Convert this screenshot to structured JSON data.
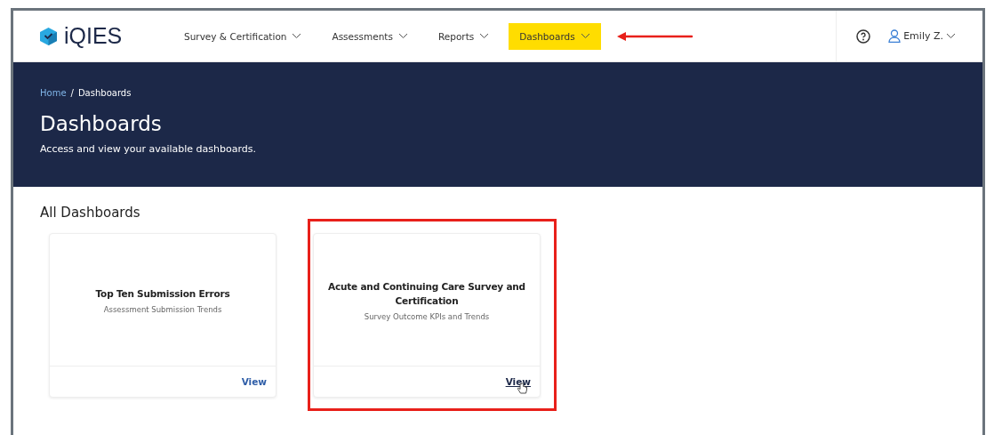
{
  "header": {
    "logo": "iQIES",
    "nav": [
      {
        "label": "Survey & Certification",
        "selected": false
      },
      {
        "label": "Assessments",
        "selected": false
      },
      {
        "label": "Reports",
        "selected": false
      },
      {
        "label": "Dashboards",
        "selected": true
      }
    ],
    "user": "Emily Z."
  },
  "banner": {
    "breadcrumb": [
      {
        "label": "Home",
        "kind": "link"
      },
      {
        "label": "/",
        "kind": "separator"
      },
      {
        "label": "Dashboards",
        "kind": "current"
      }
    ],
    "title": "Dashboards",
    "subtitle": "Access and view your available dashboards."
  },
  "section": {
    "title": "All Dashboards",
    "cards": [
      {
        "title": "Top Ten Submission Errors",
        "subtitle": "Assessment Submission Trends",
        "action": "View",
        "highlighted": false,
        "hovered": false
      },
      {
        "title": "Acute and Continuing Care Survey and Certification",
        "subtitle": "Survey Outcome KPIs and Trends",
        "action": "View",
        "highlighted": true,
        "hovered": true
      }
    ]
  }
}
